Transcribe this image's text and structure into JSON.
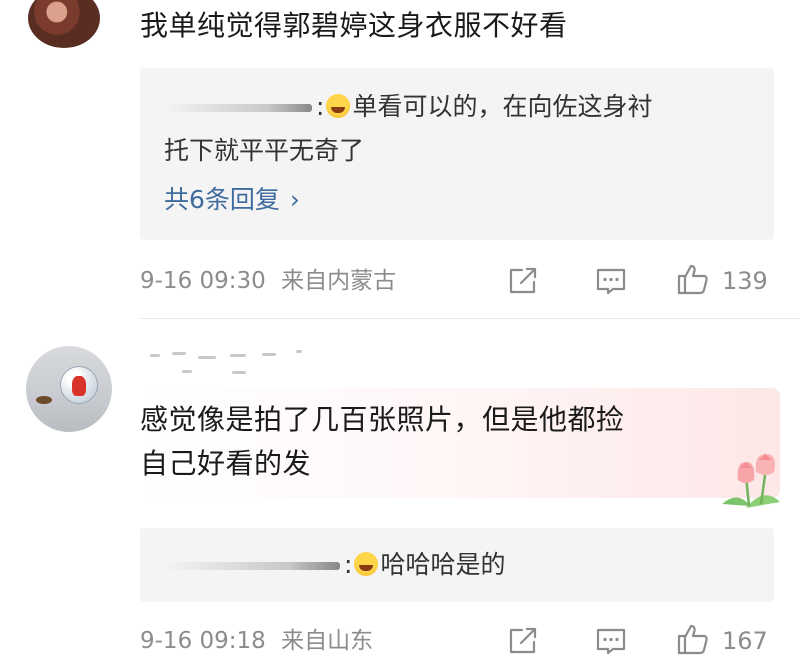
{
  "comments": [
    {
      "text": "我单纯觉得郭碧婷这身衣服不好看",
      "reply_preview": {
        "text_line1": "单看可以的，在向佐这身衬",
        "text_line2": "托下就平平无奇了",
        "more_label": "共6条回复",
        "chevron": "›"
      },
      "timestamp": "9-16 09:30",
      "location": "来自内蒙古",
      "likes": "139"
    },
    {
      "text_line1": "感觉像是拍了几百张照片，但是他都捡",
      "text_line2": "自己好看的发",
      "reply_preview": {
        "text": "哈哈哈是的"
      },
      "timestamp": "9-16 09:18",
      "location": "来自山东",
      "likes": "167"
    }
  ],
  "icons": {
    "share": "share-icon",
    "comment": "comment-icon",
    "like": "like-icon",
    "laugh_emoji": "laugh-emoji-icon",
    "tulip": "tulip-decoration-icon"
  },
  "colors": {
    "link": "#3f6c9e",
    "meta": "#8c8c8c",
    "reply_bg": "#f4f4f4"
  }
}
